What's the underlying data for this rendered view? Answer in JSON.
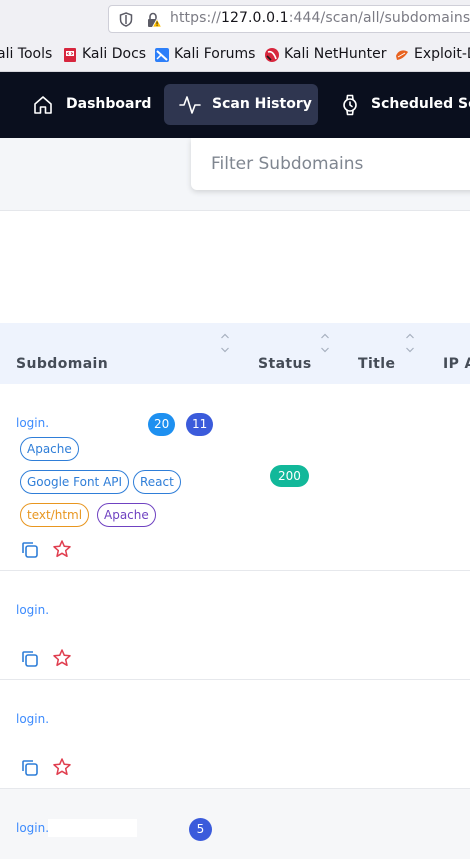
{
  "browser": {
    "url_scheme": "https://",
    "url_host": "127.0.0.1",
    "url_rest": ":444/scan/all/subdomains",
    "bookmarks": [
      "ali Tools",
      "Kali Docs",
      "Kali Forums",
      "Kali NetHunter",
      "Exploit-D"
    ]
  },
  "nav": {
    "items": [
      {
        "label": "Dashboard",
        "icon": "home-icon"
      },
      {
        "label": "Scan History",
        "icon": "activity-icon"
      },
      {
        "label": "Scheduled Sca",
        "icon": "watch-icon"
      }
    ]
  },
  "filter": {
    "placeholder": "Filter Subdomains",
    "value": ""
  },
  "table": {
    "columns": [
      "Subdomain",
      "Status",
      "Title",
      "IP A"
    ],
    "rows": [
      {
        "subdomain": "login.",
        "counts": [
          "20",
          "11"
        ],
        "tags_row1": [
          "Apache"
        ],
        "tags_row2": [
          "Google Font API",
          "React"
        ],
        "tags_row3": [
          "text/html",
          "Apache"
        ],
        "status": "200"
      },
      {
        "subdomain": "login."
      },
      {
        "subdomain": "login."
      },
      {
        "subdomain": "login.",
        "counts": [
          "5"
        ]
      }
    ]
  },
  "colors": {
    "nav_bg": "#0a0f1e",
    "nav_active": "#2f3650",
    "link": "#3d8bfd",
    "count_blue": "#1e90f0",
    "count_indigo": "#3b5bdb",
    "status_green": "#12b89a",
    "star_red": "#e03e4f"
  }
}
